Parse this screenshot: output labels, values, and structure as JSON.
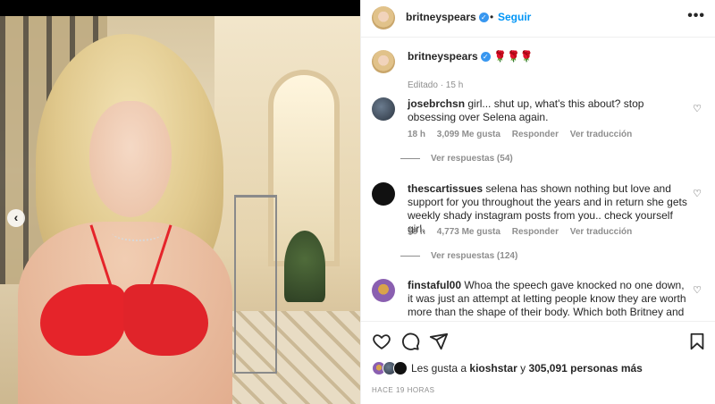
{
  "post": {
    "username": "britneyspears",
    "follow_label": "Seguir",
    "more_label": "•••",
    "carousel_prev": "‹",
    "caption": "🌹🌹🌹",
    "caption_time": "Editado · 15 h"
  },
  "comments": [
    {
      "username": "josebrchsn",
      "text": "girl... shut up, what's this about? stop obsessing over Selena again.",
      "time": "18 h",
      "likes": "3,099 Me gusta",
      "reply": "Responder",
      "translate": "Ver traducción",
      "view_replies": "Ver respuestas (54)"
    },
    {
      "username": "thescartissues",
      "text": "selena has shown nothing but love and support for you throughout the years and in return she gets weekly shady instagram posts from you.. check yourself girl.",
      "time": "18 h",
      "likes": "4,773 Me gusta",
      "reply": "Responder",
      "translate": "Ver traducción",
      "view_replies": "Ver respuestas (124)"
    },
    {
      "username": "finstaful00",
      "text": "Whoa the speech gave knocked no one down, it was just an attempt at letting people know they are worth more than the shape of their body. Which both Britney and"
    }
  ],
  "likes": {
    "prefix": "Les gusta a",
    "user": "kioshstar",
    "connector": "y",
    "others": "305,091 personas más"
  },
  "posted": "HACE 19 HORAS",
  "colors": {
    "accent": "#0095f6",
    "verified": "#3897f0",
    "muted": "#8e8e8e",
    "text": "#262626",
    "bikini": "#e5242a"
  },
  "icons": {
    "verified": "verified-badge-icon",
    "like": "heart-icon",
    "comment": "comment-icon",
    "share": "send-icon",
    "save": "bookmark-icon"
  }
}
